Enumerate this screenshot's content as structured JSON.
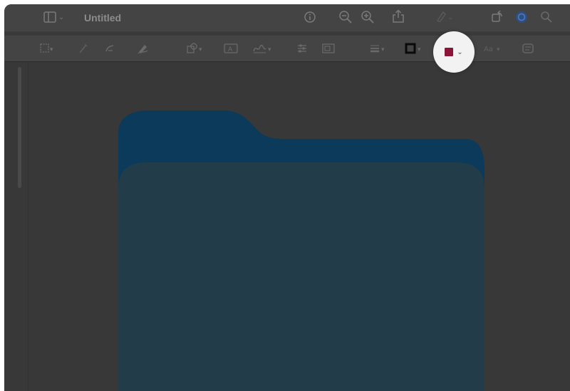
{
  "window": {
    "title": "Untitled"
  },
  "titlebar_icons": [
    "sidebar-toggle-icon",
    "info-icon",
    "zoom-out-icon",
    "zoom-in-icon",
    "share-icon",
    "markup-icon",
    "rotate-icon",
    "highlight-mode-icon",
    "search-icon"
  ],
  "toolbar_icons": [
    "selection-tool-icon",
    "instant-alpha-icon",
    "sketch-icon",
    "draw-icon",
    "shapes-icon",
    "text-box-icon",
    "sign-icon",
    "adjust-color-icon",
    "adjust-size-icon",
    "line-style-icon",
    "border-color-icon",
    "fill-color-icon",
    "text-style-icon",
    "notes-icon"
  ],
  "fill_color": {
    "value": "#8b1538"
  },
  "colors": {
    "canvas_bg": "#383838",
    "toolbar_bg": "#444444",
    "folder_back": "#0b3a5a",
    "folder_front": "#233c4a"
  }
}
